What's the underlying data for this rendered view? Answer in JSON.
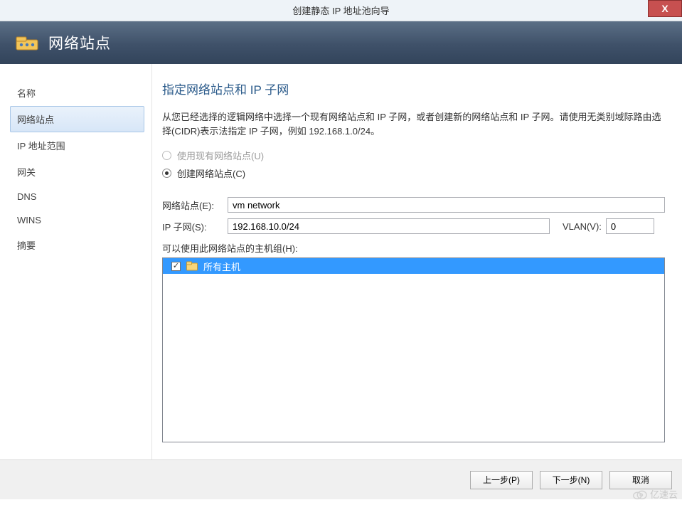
{
  "window": {
    "title": "创建静态 IP 地址池向导",
    "close_glyph": "X"
  },
  "header": {
    "title": "网络站点"
  },
  "sidebar": {
    "items": [
      {
        "label": "名称",
        "selected": false
      },
      {
        "label": "网络站点",
        "selected": true
      },
      {
        "label": "IP 地址范围",
        "selected": false
      },
      {
        "label": "网关",
        "selected": false
      },
      {
        "label": "DNS",
        "selected": false
      },
      {
        "label": "WINS",
        "selected": false
      },
      {
        "label": "摘要",
        "selected": false
      }
    ]
  },
  "content": {
    "heading": "指定网络站点和 IP 子网",
    "description": "从您已经选择的逻辑网络中选择一个现有网络站点和 IP 子网，或者创建新的网络站点和 IP 子网。请使用无类别域际路由选择(CIDR)表示法指定 IP 子网，例如 192.168.1.0/24。",
    "radio_existing": "使用现有网络站点(U)",
    "radio_create": "创建网络站点(C)",
    "radio_selected": "create",
    "site_label": "网络站点(E):",
    "site_value": "vm network",
    "subnet_label": "IP 子网(S):",
    "subnet_value": "192.168.10.0/24",
    "vlan_label": "VLAN(V):",
    "vlan_value": "0",
    "hostgroup_label": "可以使用此网络站点的主机组(H):",
    "hostgroup_items": [
      {
        "label": "所有主机",
        "checked": true
      }
    ]
  },
  "footer": {
    "prev": "上一步(P)",
    "next": "下一步(N)",
    "cancel": "取消"
  },
  "watermark": {
    "text": "亿速云"
  }
}
